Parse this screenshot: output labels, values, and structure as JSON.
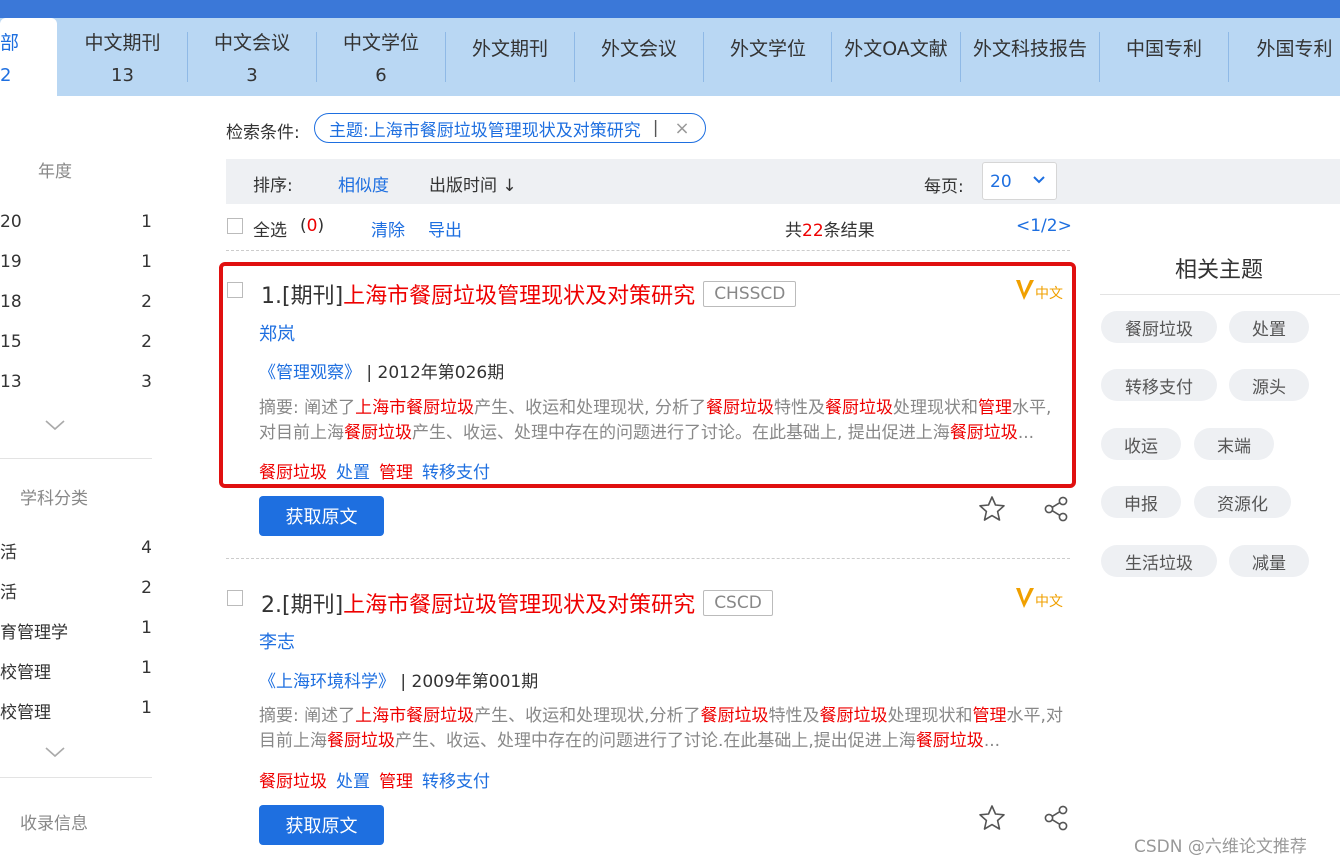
{
  "tabs": [
    {
      "label": "部",
      "count": "2",
      "active": true
    },
    {
      "label": "中文期刊",
      "count": "13"
    },
    {
      "label": "中文会议",
      "count": "3"
    },
    {
      "label": "中文学位",
      "count": "6"
    },
    {
      "label": "外文期刊",
      "count": ""
    },
    {
      "label": "外文会议",
      "count": ""
    },
    {
      "label": "外文学位",
      "count": ""
    },
    {
      "label": "外文OA文献",
      "count": ""
    },
    {
      "label": "外文科技报告",
      "count": ""
    },
    {
      "label": "中国专利",
      "count": ""
    },
    {
      "label": "外国专利",
      "count": ""
    }
  ],
  "sidebar": {
    "year_heading": "年度",
    "years": [
      {
        "label": "20",
        "count": "1"
      },
      {
        "label": "19",
        "count": "1"
      },
      {
        "label": "18",
        "count": "2"
      },
      {
        "label": "15",
        "count": "2"
      },
      {
        "label": "13",
        "count": "3"
      }
    ],
    "subject_heading": "学科分类",
    "subjects": [
      {
        "label": "活",
        "count": "4"
      },
      {
        "label": "活",
        "count": "2"
      },
      {
        "label": "育管理学",
        "count": "1"
      },
      {
        "label": "校管理",
        "count": "1"
      },
      {
        "label": "校管理",
        "count": "1"
      }
    ],
    "record_heading": "收录信息"
  },
  "search": {
    "condition_label": "检索条件:",
    "condition_value": "主题:上海市餐厨垃圾管理现状及对策研究",
    "condition_bar": "|",
    "condition_close": "×"
  },
  "sort": {
    "label": "排序:",
    "similarity": "相似度",
    "pub_time": "出版时间 ↓",
    "per_page_label": "每页:",
    "per_page_value": "20"
  },
  "controls": {
    "select_all": "全选",
    "selected_open": "(",
    "selected_count": "0",
    "selected_close": ")",
    "clear": "清除",
    "export": "导出",
    "total_prefix": "共",
    "total_count": "22",
    "total_suffix": "条结果",
    "pager": "<1/2>"
  },
  "records": [
    {
      "prefix": "1.[期刊] ",
      "title": "上海市餐厨垃圾管理现状及对策研究",
      "badge": "CHSSCD",
      "author": "郑岚",
      "journal": "《管理观察》",
      "issue": " | 2012年第026期",
      "abstract_parts": [
        {
          "text": "摘要: 阐述了",
          "hl": false
        },
        {
          "text": "上海市餐厨垃圾",
          "hl": true
        },
        {
          "text": "产生、收运和处理现状, 分析了",
          "hl": false
        },
        {
          "text": "餐厨垃圾",
          "hl": true
        },
        {
          "text": "特性及",
          "hl": false
        },
        {
          "text": "餐厨垃圾",
          "hl": true
        },
        {
          "text": "处理现状和",
          "hl": false
        },
        {
          "text": "管理",
          "hl": true
        },
        {
          "text": "水平, 对目前上海",
          "hl": false
        },
        {
          "text": "餐厨垃圾",
          "hl": true
        },
        {
          "text": "产生、收运、处理中存在的问题进行了讨论。在此基础上, 提出促进上海",
          "hl": false
        },
        {
          "text": "餐厨垃圾",
          "hl": true
        },
        {
          "text": "...",
          "hl": false
        }
      ],
      "keywords": [
        {
          "text": "餐厨垃圾",
          "hl": true
        },
        {
          "text": "处置",
          "hl": false
        },
        {
          "text": "管理",
          "hl": true
        },
        {
          "text": "转移支付",
          "hl": false
        }
      ],
      "vbadge_text": "中文",
      "button": "获取原文"
    },
    {
      "prefix": "2.[期刊] ",
      "title": "上海市餐厨垃圾管理现状及对策研究",
      "badge": "CSCD",
      "author": "李志",
      "journal": "《上海环境科学》",
      "issue": " | 2009年第001期",
      "abstract_parts": [
        {
          "text": "摘要: 阐述了",
          "hl": false
        },
        {
          "text": "上海市餐厨垃圾",
          "hl": true
        },
        {
          "text": "产生、收运和处理现状,分析了",
          "hl": false
        },
        {
          "text": "餐厨垃圾",
          "hl": true
        },
        {
          "text": "特性及",
          "hl": false
        },
        {
          "text": "餐厨垃圾",
          "hl": true
        },
        {
          "text": "处理现状和",
          "hl": false
        },
        {
          "text": "管理",
          "hl": true
        },
        {
          "text": "水平,对目前上海",
          "hl": false
        },
        {
          "text": "餐厨垃圾",
          "hl": true
        },
        {
          "text": "产生、收运、处理中存在的问题进行了讨论.在此基础上,提出促进上海",
          "hl": false
        },
        {
          "text": "餐厨垃圾",
          "hl": true
        },
        {
          "text": "...",
          "hl": false
        }
      ],
      "keywords": [
        {
          "text": "餐厨垃圾",
          "hl": true
        },
        {
          "text": "处置",
          "hl": false
        },
        {
          "text": "管理",
          "hl": true
        },
        {
          "text": "转移支付",
          "hl": false
        }
      ],
      "vbadge_text": "中文",
      "button": "获取原文"
    }
  ],
  "related": {
    "title": "相关主题",
    "topics": [
      "餐厨垃圾",
      "处置",
      "转移支付",
      "源头",
      "收运",
      "末端",
      "申报",
      "资源化",
      "生活垃圾",
      "减量"
    ]
  },
  "watermark": "CSDN @六维论文推荐",
  "colors": {
    "accent": "#1e6fe0",
    "highlight": "#e00000",
    "tabbar": "#b9d7f3",
    "annotation_box": "#e01010",
    "vip": "#f0a000"
  }
}
